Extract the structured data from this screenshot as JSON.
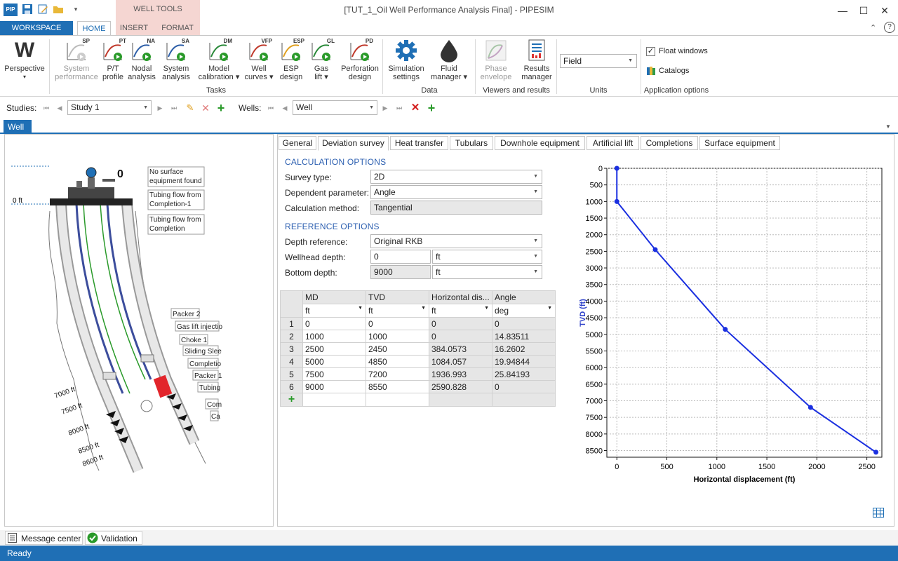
{
  "app": {
    "title": "[TUT_1_Oil Well Performance Analysis Final] - PIPESIM",
    "icon_text": "PIP",
    "contextual_tab_group": "WELL TOOLS"
  },
  "ribbon_tabs": [
    "WORKSPACE",
    "HOME",
    "INSERT",
    "FORMAT"
  ],
  "ribbon": {
    "perspective": {
      "label": "Perspective",
      "glyph": "W"
    },
    "tasks": [
      {
        "label1": "System",
        "label2": "performance",
        "badge": "SP",
        "icon": "system-performance-icon",
        "enabled": false
      },
      {
        "label1": "P/T",
        "label2": "profile",
        "badge": "PT",
        "icon": "pt-profile-icon",
        "enabled": true
      },
      {
        "label1": "Nodal",
        "label2": "analysis",
        "badge": "NA",
        "icon": "nodal-analysis-icon",
        "enabled": true
      },
      {
        "label1": "System",
        "label2": "analysis",
        "badge": "SA",
        "icon": "system-analysis-icon",
        "enabled": true
      },
      {
        "label1": "Model",
        "label2": "calibration ▾",
        "badge": "DM",
        "icon": "model-calibration-icon",
        "enabled": true
      },
      {
        "label1": "Well",
        "label2": "curves ▾",
        "badge": "VFP",
        "icon": "well-curves-icon",
        "enabled": true
      },
      {
        "label1": "ESP",
        "label2": "design",
        "badge": "ESP",
        "icon": "esp-design-icon",
        "enabled": true
      },
      {
        "label1": "Gas",
        "label2": "lift ▾",
        "badge": "GL",
        "icon": "gas-lift-icon",
        "enabled": true
      },
      {
        "label1": "Perforation",
        "label2": "design",
        "badge": "PD",
        "icon": "perforation-design-icon",
        "enabled": true
      }
    ],
    "data": [
      {
        "label1": "Simulation",
        "label2": "settings",
        "icon": "gear-icon"
      },
      {
        "label1": "Fluid",
        "label2": "manager ▾",
        "icon": "oil-drop-icon"
      }
    ],
    "viewers": [
      {
        "label1": "Phase",
        "label2": "envelope",
        "icon": "phase-envelope-icon",
        "enabled": false
      },
      {
        "label1": "Results",
        "label2": "manager",
        "icon": "results-manager-icon",
        "enabled": true
      }
    ],
    "units_value": "Field",
    "float_windows": "Float windows",
    "catalogs": "Catalogs",
    "groups": {
      "tasks": "Tasks",
      "data": "Data",
      "viewers": "Viewers and results",
      "units": "Units",
      "app_options": "Application options"
    }
  },
  "studies": {
    "label": "Studies:",
    "value": "Study 1"
  },
  "wells": {
    "label": "Wells:",
    "value": "Well"
  },
  "doc_tab": "Well",
  "schematic": {
    "surface_note": "No surface equipment found",
    "callouts": [
      "Tubing flow from Completion-1",
      "Tubing flow from Completion",
      "Packer 2",
      "Gas lift injectio",
      "Choke 1",
      "Sliding Slee",
      "Completio",
      "Packer 1",
      "Tubing",
      "Com",
      "Ca"
    ],
    "depths": [
      "0 ft",
      "7000 ft",
      "7500 ft",
      "8000 ft",
      "8500 ft",
      "8600 ft"
    ],
    "wellhead_label": "0"
  },
  "panel_tabs": [
    "General",
    "Deviation survey",
    "Heat transfer",
    "Tubulars",
    "Downhole equipment",
    "Artificial lift",
    "Completions",
    "Surface equipment"
  ],
  "calc_options": {
    "header": "CALCULATION OPTIONS",
    "survey_type_label": "Survey type:",
    "survey_type": "2D",
    "dep_param_label": "Dependent parameter:",
    "dep_param": "Angle",
    "calc_method_label": "Calculation method:",
    "calc_method": "Tangential"
  },
  "ref_options": {
    "header": "REFERENCE OPTIONS",
    "depth_ref_label": "Depth reference:",
    "depth_ref": "Original RKB",
    "wellhead_label": "Wellhead depth:",
    "wellhead": "0",
    "wellhead_unit": "ft",
    "bottom_label": "Bottom depth:",
    "bottom": "9000",
    "bottom_unit": "ft"
  },
  "survey_table": {
    "columns": [
      "MD",
      "TVD",
      "Horizontal dis...",
      "Angle"
    ],
    "units": [
      "ft",
      "ft",
      "ft",
      "deg"
    ],
    "rows": [
      [
        "1",
        "0",
        "0",
        "0",
        "0"
      ],
      [
        "2",
        "1000",
        "1000",
        "0",
        "14.83511"
      ],
      [
        "3",
        "2500",
        "2450",
        "384.0573",
        "16.2602"
      ],
      [
        "4",
        "5000",
        "4850",
        "1084.057",
        "19.94844"
      ],
      [
        "5",
        "7500",
        "7200",
        "1936.993",
        "25.84193"
      ],
      [
        "6",
        "9000",
        "8550",
        "2590.828",
        "0"
      ]
    ]
  },
  "chart_data": {
    "type": "line",
    "x": [
      0,
      0,
      384.0573,
      1084.057,
      1936.993,
      2590.828
    ],
    "y": [
      0,
      1000,
      2450,
      4850,
      7200,
      8550
    ],
    "xlabel": "Horizontal displacement (ft)",
    "ylabel": "TVD (ft)",
    "xlim": [
      -100,
      2650
    ],
    "ylim": [
      0,
      8700
    ],
    "y_inverted": true,
    "xticks": [
      0,
      500,
      1000,
      1500,
      2000,
      2500
    ],
    "yticks": [
      0,
      500,
      1000,
      1500,
      2000,
      2500,
      3000,
      3500,
      4000,
      4500,
      5000,
      5500,
      6000,
      6500,
      7000,
      7500,
      8000,
      8500
    ],
    "grid": true,
    "color": "#1a2fe0"
  },
  "bottom_tabs": [
    "Message center",
    "Validation"
  ],
  "status": "Ready"
}
